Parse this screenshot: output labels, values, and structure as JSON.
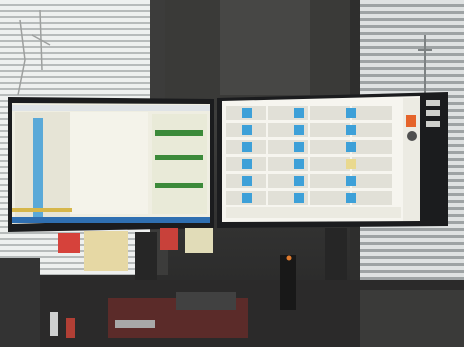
{
  "scene": {
    "description_tag": "photo-two-monitors-on-desk",
    "palette": {
      "wall": "#3a3a38",
      "window_light": "#e9eceb",
      "blind": "#b9bdbc",
      "bezel": "#1b1c1e",
      "left_screen_bg": "#f2f1e6",
      "left_screen_left_panel": "#e7e6d8",
      "left_screen_bar": "#5aa9d8",
      "right_screen_bg": "#f6f5ef",
      "tile_blue": "#3da0d8",
      "tile_yellow": "#e9d98f",
      "orange_icon": "#e5642b",
      "sticky_red": "#d6423b",
      "sticky_yellow": "#e6d8a4",
      "desk": "#2b2a2a"
    }
  }
}
